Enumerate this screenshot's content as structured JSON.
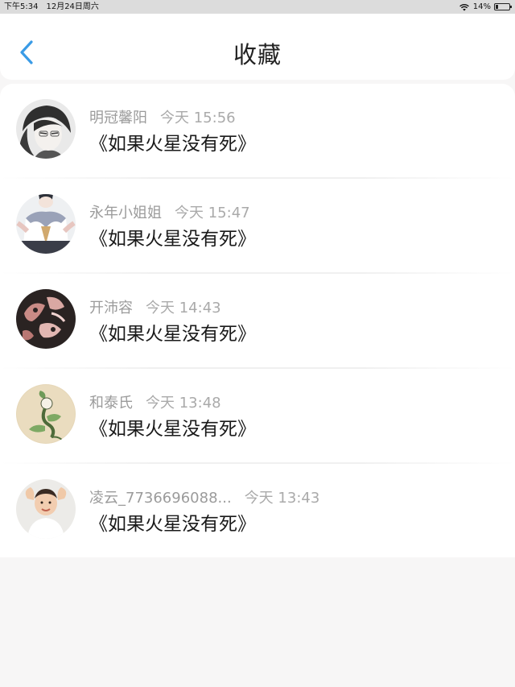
{
  "status_bar": {
    "time": "下午5:34",
    "date": "12月24日周六",
    "battery": "14%"
  },
  "header": {
    "title": "收藏",
    "back_icon": "chevron-left-icon",
    "accent_color": "#3a9be6"
  },
  "favorites": [
    {
      "author": "明冠馨阳",
      "time": "今天 15:56",
      "text": "《如果火星没有死》",
      "avatar": "anime-character-avatar"
    },
    {
      "author": "永年小姐姐",
      "time": "今天 15:47",
      "text": "《如果火星没有死》",
      "avatar": "schoolgirl-avatar"
    },
    {
      "author": "开沛容",
      "time": "今天 14:43",
      "text": "《如果火星没有死》",
      "avatar": "dark-artwork-avatar"
    },
    {
      "author": "和泰氏",
      "time": "今天 13:48",
      "text": "《如果火星没有死》",
      "avatar": "plant-creature-avatar"
    },
    {
      "author": "凌云_7736696088...",
      "time": "今天 13:43",
      "text": "《如果火星没有死》",
      "avatar": "child-photo-avatar"
    }
  ]
}
